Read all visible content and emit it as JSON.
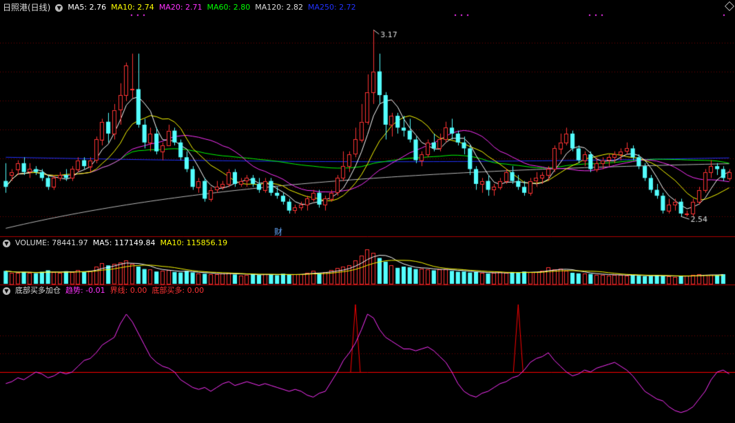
{
  "colors": {
    "up": "#ff3333",
    "down": "#54ffff",
    "ma5": "#ffffff",
    "ma10": "#ffff00",
    "ma20": "#ff33ff",
    "ma60": "#00ff00",
    "ma120": "#bbbbbb",
    "ma250": "#2233ff",
    "trend": "#ff33ff",
    "line": "#ff0000",
    "grid": "#7a0000"
  },
  "price_panel": {
    "title": "日照港(日线)",
    "ma_labels": [
      {
        "text": "MA5: 2.76",
        "color": "#ffffff"
      },
      {
        "text": "MA10: 2.74",
        "color": "#ffff00"
      },
      {
        "text": "MA20: 2.71",
        "color": "#ff33ff"
      },
      {
        "text": "MA60: 2.80",
        "color": "#00ff00"
      },
      {
        "text": "MA120: 2.82",
        "color": "#dddddd"
      },
      {
        "text": "MA250: 2.72",
        "color": "#2233ff"
      }
    ],
    "high_label": "3.17",
    "low_label": "2.54",
    "event_label": "财"
  },
  "volume_panel": {
    "labels": [
      {
        "text": "VOLUME: 78441.97",
        "color": "#dddddd"
      },
      {
        "text": "MA5: 117149.84",
        "color": "#ffffff"
      },
      {
        "text": "MA10: 115856.19",
        "color": "#ffff00"
      }
    ]
  },
  "indicator_panel": {
    "labels": [
      {
        "text": "底部买多加仓",
        "color": "#dddddd"
      },
      {
        "text": "趋势: -0.01",
        "color": "#ff33ff"
      },
      {
        "text": "界线: 0.00",
        "color": "#ff3333"
      },
      {
        "text": "底部买多: 0.00",
        "color": "#ff3333"
      }
    ]
  },
  "chart_data": {
    "type": "candlestick",
    "title": "日照港(日线)",
    "y_range": [
      2.48,
      3.22
    ],
    "candles": [
      [
        2.66,
        2.72,
        2.62,
        2.64
      ],
      [
        2.68,
        2.7,
        2.66,
        2.69
      ],
      [
        2.7,
        2.73,
        2.68,
        2.72
      ],
      [
        2.72,
        2.74,
        2.68,
        2.69
      ],
      [
        2.69,
        2.72,
        2.67,
        2.7
      ],
      [
        2.7,
        2.71,
        2.68,
        2.69
      ],
      [
        2.69,
        2.7,
        2.66,
        2.67
      ],
      [
        2.67,
        2.68,
        2.63,
        2.64
      ],
      [
        2.64,
        2.68,
        2.63,
        2.67
      ],
      [
        2.67,
        2.69,
        2.66,
        2.68
      ],
      [
        2.68,
        2.7,
        2.66,
        2.67
      ],
      [
        2.67,
        2.71,
        2.66,
        2.7
      ],
      [
        2.7,
        2.74,
        2.69,
        2.73
      ],
      [
        2.73,
        2.74,
        2.7,
        2.71
      ],
      [
        2.71,
        2.74,
        2.69,
        2.73
      ],
      [
        2.73,
        2.81,
        2.72,
        2.8
      ],
      [
        2.8,
        2.87,
        2.78,
        2.86
      ],
      [
        2.86,
        2.89,
        2.79,
        2.82
      ],
      [
        2.82,
        2.92,
        2.8,
        2.9
      ],
      [
        2.9,
        2.99,
        2.85,
        2.95
      ],
      [
        2.95,
        3.06,
        2.93,
        3.05
      ],
      [
        2.97,
        3.09,
        2.94,
        2.97
      ],
      [
        2.97,
        3.09,
        2.84,
        2.85
      ],
      [
        2.85,
        2.87,
        2.77,
        2.79
      ],
      [
        2.79,
        2.84,
        2.76,
        2.82
      ],
      [
        2.82,
        2.84,
        2.75,
        2.76
      ],
      [
        2.76,
        2.79,
        2.73,
        2.78
      ],
      [
        2.78,
        2.85,
        2.78,
        2.83
      ],
      [
        2.83,
        2.84,
        2.78,
        2.79
      ],
      [
        2.79,
        2.8,
        2.73,
        2.74
      ],
      [
        2.74,
        2.76,
        2.69,
        2.7
      ],
      [
        2.7,
        2.71,
        2.63,
        2.64
      ],
      [
        2.64,
        2.67,
        2.62,
        2.66
      ],
      [
        2.66,
        2.67,
        2.59,
        2.6
      ],
      [
        2.6,
        2.64,
        2.59,
        2.63
      ],
      [
        2.63,
        2.66,
        2.62,
        2.64
      ],
      [
        2.64,
        2.66,
        2.63,
        2.65
      ],
      [
        2.65,
        2.7,
        2.64,
        2.69
      ],
      [
        2.69,
        2.7,
        2.64,
        2.65
      ],
      [
        2.65,
        2.67,
        2.64,
        2.66
      ],
      [
        2.66,
        2.68,
        2.64,
        2.67
      ],
      [
        2.67,
        2.68,
        2.64,
        2.65
      ],
      [
        2.65,
        2.67,
        2.62,
        2.63
      ],
      [
        2.63,
        2.67,
        2.62,
        2.66
      ],
      [
        2.66,
        2.67,
        2.61,
        2.62
      ],
      [
        2.62,
        2.64,
        2.6,
        2.61
      ],
      [
        2.61,
        2.62,
        2.58,
        2.59
      ],
      [
        2.59,
        2.6,
        2.55,
        2.56
      ],
      [
        2.56,
        2.58,
        2.55,
        2.57
      ],
      [
        2.57,
        2.59,
        2.56,
        2.58
      ],
      [
        2.58,
        2.61,
        2.56,
        2.6
      ],
      [
        2.6,
        2.63,
        2.59,
        2.62
      ],
      [
        2.62,
        2.63,
        2.57,
        2.58
      ],
      [
        2.58,
        2.61,
        2.56,
        2.6
      ],
      [
        2.6,
        2.63,
        2.59,
        2.62
      ],
      [
        2.62,
        2.68,
        2.61,
        2.67
      ],
      [
        2.67,
        2.76,
        2.66,
        2.71
      ],
      [
        2.71,
        2.76,
        2.69,
        2.75
      ],
      [
        2.75,
        2.84,
        2.74,
        2.8
      ],
      [
        2.8,
        2.92,
        2.79,
        2.86
      ],
      [
        2.86,
        3.02,
        2.85,
        2.96
      ],
      [
        2.96,
        3.17,
        2.92,
        3.03
      ],
      [
        3.03,
        3.09,
        2.92,
        2.95
      ],
      [
        2.95,
        2.96,
        2.8,
        2.85
      ],
      [
        2.85,
        2.89,
        2.81,
        2.88
      ],
      [
        2.88,
        2.89,
        2.82,
        2.84
      ],
      [
        2.84,
        2.88,
        2.81,
        2.83
      ],
      [
        2.83,
        2.87,
        2.79,
        2.8
      ],
      [
        2.8,
        2.81,
        2.72,
        2.73
      ],
      [
        2.73,
        2.76,
        2.71,
        2.75
      ],
      [
        2.75,
        2.8,
        2.74,
        2.79
      ],
      [
        2.79,
        2.82,
        2.76,
        2.77
      ],
      [
        2.77,
        2.82,
        2.76,
        2.8
      ],
      [
        2.8,
        2.86,
        2.79,
        2.84
      ],
      [
        2.84,
        2.87,
        2.8,
        2.82
      ],
      [
        2.82,
        2.83,
        2.78,
        2.79
      ],
      [
        2.79,
        2.81,
        2.75,
        2.77
      ],
      [
        2.77,
        2.78,
        2.68,
        2.7
      ],
      [
        2.7,
        2.71,
        2.63,
        2.65
      ],
      [
        2.65,
        2.67,
        2.62,
        2.66
      ],
      [
        2.66,
        2.68,
        2.61,
        2.63
      ],
      [
        2.63,
        2.65,
        2.61,
        2.64
      ],
      [
        2.64,
        2.67,
        2.63,
        2.66
      ],
      [
        2.66,
        2.7,
        2.65,
        2.69
      ],
      [
        2.69,
        2.71,
        2.65,
        2.66
      ],
      [
        2.66,
        2.68,
        2.63,
        2.64
      ],
      [
        2.64,
        2.66,
        2.61,
        2.62
      ],
      [
        2.62,
        2.67,
        2.61,
        2.66
      ],
      [
        2.66,
        2.69,
        2.64,
        2.67
      ],
      [
        2.67,
        2.69,
        2.65,
        2.68
      ],
      [
        2.68,
        2.71,
        2.66,
        2.7
      ],
      [
        2.7,
        2.78,
        2.69,
        2.77
      ],
      [
        2.77,
        2.82,
        2.75,
        2.79
      ],
      [
        2.79,
        2.84,
        2.78,
        2.82
      ],
      [
        2.82,
        2.83,
        2.76,
        2.77
      ],
      [
        2.77,
        2.78,
        2.72,
        2.73
      ],
      [
        2.73,
        2.76,
        2.71,
        2.75
      ],
      [
        2.75,
        2.76,
        2.69,
        2.7
      ],
      [
        2.7,
        2.74,
        2.69,
        2.72
      ],
      [
        2.72,
        2.74,
        2.7,
        2.73
      ],
      [
        2.73,
        2.75,
        2.71,
        2.74
      ],
      [
        2.74,
        2.76,
        2.72,
        2.75
      ],
      [
        2.75,
        2.77,
        2.73,
        2.76
      ],
      [
        2.76,
        2.79,
        2.75,
        2.77
      ],
      [
        2.77,
        2.78,
        2.73,
        2.74
      ],
      [
        2.74,
        2.75,
        2.7,
        2.71
      ],
      [
        2.71,
        2.72,
        2.66,
        2.67
      ],
      [
        2.67,
        2.68,
        2.62,
        2.63
      ],
      [
        2.63,
        2.65,
        2.6,
        2.61
      ],
      [
        2.61,
        2.62,
        2.55,
        2.56
      ],
      [
        2.56,
        2.6,
        2.55,
        2.58
      ],
      [
        2.58,
        2.6,
        2.56,
        2.59
      ],
      [
        2.59,
        2.6,
        2.54,
        2.55
      ],
      [
        2.55,
        2.56,
        2.54,
        2.55
      ],
      [
        2.55,
        2.6,
        2.54,
        2.59
      ],
      [
        2.59,
        2.64,
        2.58,
        2.63
      ],
      [
        2.63,
        2.7,
        2.62,
        2.69
      ],
      [
        2.69,
        2.73,
        2.67,
        2.71
      ],
      [
        2.71,
        2.72,
        2.68,
        2.7
      ],
      [
        2.7,
        2.71,
        2.66,
        2.67
      ],
      [
        2.67,
        2.7,
        2.66,
        2.69
      ]
    ],
    "volume": [
      105000,
      92000,
      88000,
      96000,
      90000,
      86000,
      98000,
      110000,
      95000,
      88000,
      102000,
      94000,
      112000,
      98000,
      108000,
      140000,
      170000,
      150000,
      160000,
      175000,
      190000,
      160000,
      140000,
      120000,
      115000,
      100000,
      108000,
      112000,
      96000,
      92000,
      104000,
      92000,
      86000,
      82000,
      78000,
      80000,
      84000,
      92000,
      76000,
      70000,
      74000,
      78000,
      72000,
      80000,
      76000,
      70000,
      82000,
      74000,
      78000,
      80000,
      92000,
      104000,
      86000,
      94000,
      110000,
      130000,
      140000,
      150000,
      190000,
      230000,
      280000,
      250000,
      210000,
      180000,
      150000,
      130000,
      140000,
      135000,
      120000,
      125000,
      118000,
      110000,
      115000,
      120000,
      105000,
      98000,
      100000,
      92000,
      96000,
      88000,
      84000,
      90000,
      94000,
      88000,
      96000,
      92000,
      100000,
      94000,
      98000,
      108000,
      135000,
      120000,
      125000,
      105000,
      90000,
      85000,
      82000,
      80000,
      75000,
      72000,
      70000,
      74000,
      72000,
      68000,
      70000,
      66000,
      62000,
      64000,
      70000,
      66000,
      60000,
      58000,
      62000,
      68000,
      72000,
      76000,
      74000,
      72000,
      70000,
      78441
    ],
    "trend": [
      -0.06,
      -0.05,
      -0.03,
      -0.04,
      -0.02,
      0.0,
      -0.01,
      -0.03,
      -0.02,
      0.0,
      -0.01,
      0.0,
      0.03,
      0.06,
      0.07,
      0.1,
      0.14,
      0.16,
      0.18,
      0.25,
      0.3,
      0.26,
      0.2,
      0.14,
      0.08,
      0.05,
      0.03,
      0.02,
      0.0,
      -0.04,
      -0.06,
      -0.08,
      -0.09,
      -0.08,
      -0.1,
      -0.08,
      -0.06,
      -0.05,
      -0.07,
      -0.06,
      -0.05,
      -0.06,
      -0.07,
      -0.06,
      -0.07,
      -0.08,
      -0.09,
      -0.1,
      -0.09,
      -0.1,
      -0.12,
      -0.13,
      -0.11,
      -0.1,
      -0.05,
      0.0,
      0.06,
      0.1,
      0.15,
      0.22,
      0.3,
      0.28,
      0.22,
      0.18,
      0.16,
      0.14,
      0.12,
      0.12,
      0.11,
      0.12,
      0.13,
      0.11,
      0.08,
      0.05,
      0.0,
      -0.06,
      -0.1,
      -0.12,
      -0.13,
      -0.11,
      -0.1,
      -0.08,
      -0.06,
      -0.05,
      -0.03,
      -0.02,
      0.01,
      0.05,
      0.07,
      0.08,
      0.1,
      0.06,
      0.03,
      0.0,
      -0.02,
      -0.01,
      0.01,
      0.0,
      0.02,
      0.03,
      0.04,
      0.05,
      0.03,
      0.01,
      -0.02,
      -0.06,
      -0.1,
      -0.12,
      -0.14,
      -0.15,
      -0.18,
      -0.2,
      -0.21,
      -0.2,
      -0.18,
      -0.14,
      -0.1,
      -0.04,
      0.0,
      0.01,
      -0.01
    ],
    "signal_spikes": [
      {
        "index": 58,
        "value": 0.35
      },
      {
        "index": 85,
        "value": 0.35
      }
    ]
  }
}
